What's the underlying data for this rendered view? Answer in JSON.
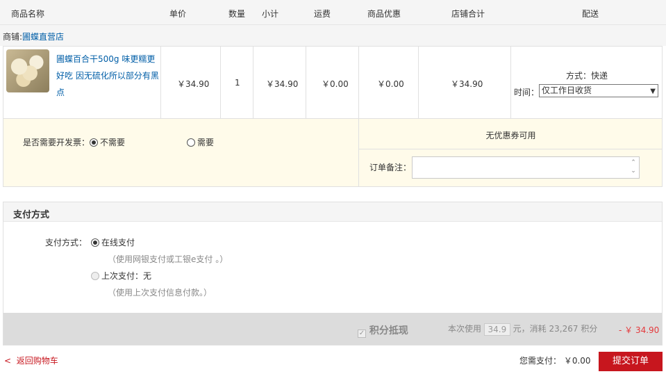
{
  "header": {
    "col_name": "商品名称",
    "col_price": "单价",
    "col_qty": "数量",
    "col_subtotal": "小计",
    "col_freight": "运费",
    "col_discount": "商品优惠",
    "col_shop_total": "店铺合计",
    "col_delivery": "配送"
  },
  "shop": {
    "prefix": "商铺:",
    "name": "圃蝶直营店"
  },
  "product": {
    "name": "圃蝶百合干500g 味更糯更好吃 因无硫化所以部分有黑点",
    "price": "￥34.90",
    "qty": "1",
    "subtotal": "￥34.90",
    "freight": "￥0.00",
    "discount": "￥0.00",
    "shop_total": "￥34.90",
    "ship_method": "方式：快递",
    "ship_time_label": "时间：",
    "ship_time_value": "仅工作日收货"
  },
  "invoice": {
    "question": "是否需要开发票：",
    "option_no": "不需要",
    "option_yes": "需要",
    "selected": "不需要"
  },
  "coupon": {
    "text": "无优惠券可用"
  },
  "remark": {
    "label": "订单备注：",
    "value": ""
  },
  "payment": {
    "section_title": "支付方式",
    "label": "支付方式：",
    "online_label": "在线支付",
    "online_hint": "（使用网银支付或工银e支付 。）",
    "last_label": "上次支付：无",
    "last_hint": "（使用上次支付信息付款。）",
    "selected": "在线支付"
  },
  "points": {
    "label": "积分抵现",
    "use_prefix": "本次使用",
    "use_value": "34.9",
    "use_suffix": "元，消耗",
    "consume_value": "23,267",
    "consume_unit": "积分",
    "deduction": "- ￥ 34.90",
    "enabled": true
  },
  "footer": {
    "back_arrow": "<",
    "back_label": "返回购物车",
    "due_label": "您需支付：",
    "due_value": "￥0.00",
    "submit_label": "提交订单"
  },
  "colors": {
    "link": "#005ea7",
    "accent_red": "#c7161e",
    "invoice_bg": "#fffbea",
    "header_bg": "#f5f5f5",
    "points_bar": "#dcdcdc"
  }
}
